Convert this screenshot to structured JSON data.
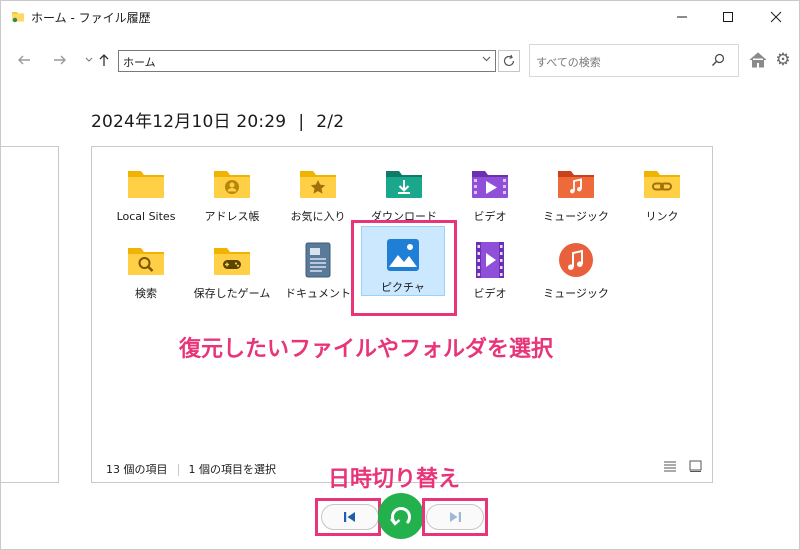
{
  "window": {
    "title": "ホーム - ファイル履歴"
  },
  "toolbar": {
    "address": "ホーム",
    "search_placeholder": "すべての検索"
  },
  "snapshot": {
    "datetime": "2024年12月10日 20:29",
    "separator": "|",
    "page": "2/2"
  },
  "items": [
    {
      "label": "Local Sites",
      "icon": "folder-icon"
    },
    {
      "label": "アドレス帳",
      "icon": "contacts-folder-icon"
    },
    {
      "label": "お気に入り",
      "icon": "favorites-folder-icon"
    },
    {
      "label": "ダウンロード",
      "icon": "downloads-folder-icon"
    },
    {
      "label": "ビデオ",
      "icon": "videos-folder-icon"
    },
    {
      "label": "ミュージック",
      "icon": "music-folder-icon"
    },
    {
      "label": "リンク",
      "icon": "links-folder-icon"
    },
    {
      "label": "検索",
      "icon": "searches-folder-icon"
    },
    {
      "label": "保存したゲーム",
      "icon": "saved-games-folder-icon"
    },
    {
      "label": "ドキュメント",
      "icon": "documents-icon"
    },
    {
      "label": "ピクチャ",
      "icon": "pictures-icon"
    },
    {
      "label": "ビデオ",
      "icon": "videos-icon"
    },
    {
      "label": "ミュージック",
      "icon": "music-icon"
    }
  ],
  "status": {
    "count": "13 個の項目",
    "selected": "1 個の項目を選択"
  },
  "annotations": {
    "select_hint": "復元したいファイルやフォルダを選択",
    "switch_hint": "日時切り替え"
  },
  "colors": {
    "accent": "#e8357a",
    "restore": "#22b14c",
    "selection": "#cce8ff"
  }
}
